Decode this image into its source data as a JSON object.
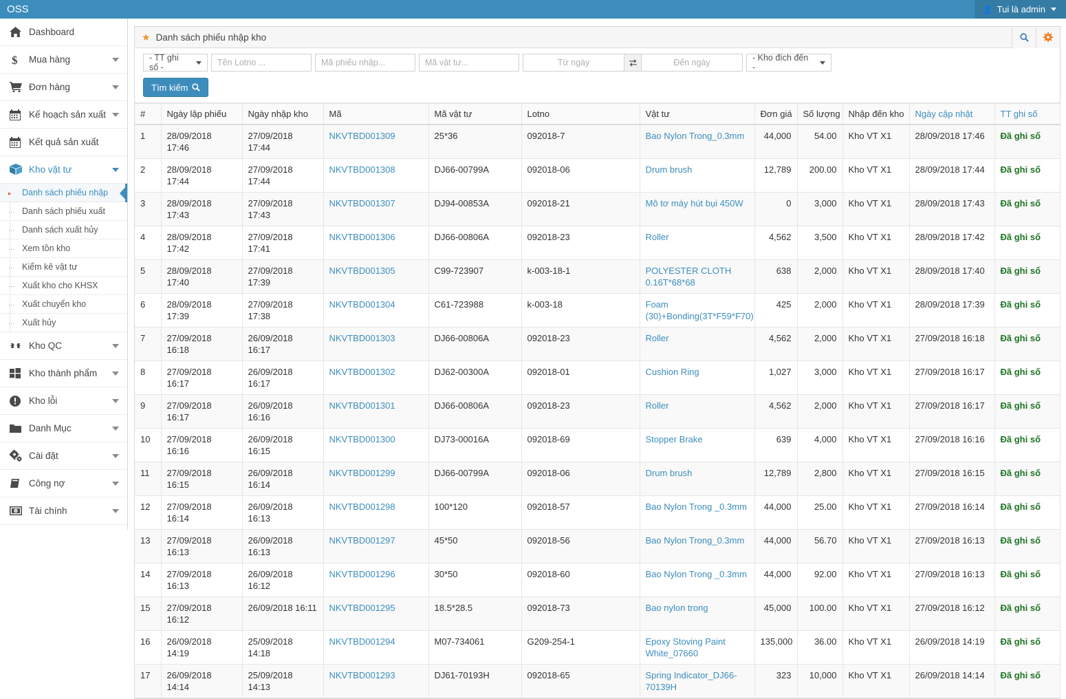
{
  "topbar": {
    "brand": "OSS",
    "user_label": "Tui là admin",
    "user_icon": "user-icon",
    "caret_icon": "caret-down-icon"
  },
  "sidebar": {
    "items": [
      {
        "label": "Dashboard",
        "icon": "home-icon",
        "has_chevron": false,
        "active": false
      },
      {
        "label": "Mua hàng",
        "icon": "dollar-icon",
        "has_chevron": true,
        "active": false
      },
      {
        "label": "Đơn hàng",
        "icon": "cart-icon",
        "has_chevron": true,
        "active": false
      },
      {
        "label": "Kế hoạch sản xuất",
        "icon": "calendar-icon",
        "has_chevron": true,
        "active": false
      },
      {
        "label": "Kết quả sản xuất",
        "icon": "calendar-icon",
        "has_chevron": false,
        "active": false
      },
      {
        "label": "Kho vật tư",
        "icon": "box-icon",
        "has_chevron": true,
        "active": true
      }
    ],
    "submenu": [
      {
        "label": "Danh sách phiếu nhập",
        "active": true
      },
      {
        "label": "Danh sách phiếu xuất",
        "active": false
      },
      {
        "label": "Danh sách xuất hủy",
        "active": false
      },
      {
        "label": "Xem tồn kho",
        "active": false
      },
      {
        "label": "Kiểm kê vật tư",
        "active": false
      },
      {
        "label": "Xuất kho cho KHSX",
        "active": false
      },
      {
        "label": "Xuất chuyển kho",
        "active": false
      },
      {
        "label": "Xuất hủy",
        "active": false
      }
    ],
    "items_after": [
      {
        "label": "Kho QC",
        "icon": "qc-icon",
        "has_chevron": true
      },
      {
        "label": "Kho thành phẩm",
        "icon": "windows-icon",
        "has_chevron": true
      },
      {
        "label": "Kho lỗi",
        "icon": "exclamation-icon",
        "has_chevron": true
      },
      {
        "label": "Danh Mục",
        "icon": "folder-icon",
        "has_chevron": true
      },
      {
        "label": "Cài đặt",
        "icon": "gears-icon",
        "has_chevron": true
      },
      {
        "label": "Công nợ",
        "icon": "book-icon",
        "has_chevron": true
      },
      {
        "label": "Tài chính",
        "icon": "money-icon",
        "has_chevron": true
      }
    ]
  },
  "panel": {
    "title": "Danh sách phiếu nhập kho",
    "star_icon": "star-icon",
    "search_icon": "search-icon",
    "gear_icon": "gear-icon"
  },
  "filters": {
    "status_select": "- TT ghi số -",
    "lotno_placeholder": "Tên Lotno ...",
    "ma_phieu_placeholder": "Mã phiếu nhập...",
    "ma_vattu_placeholder": "Mã vật tư...",
    "tu_ngay_placeholder": "Từ ngày",
    "den_ngay_placeholder": "Đến ngày",
    "swap_icon": "swap-arrows-icon",
    "kho_select": "- Kho đích đến -",
    "search_button": "Tìm kiếm",
    "search_button_icon": "search-icon"
  },
  "table": {
    "headers": [
      "#",
      "Ngày lập phiếu",
      "Ngày nhập kho",
      "Mã",
      "Mã vật tư",
      "Lotno",
      "Vật tư",
      "Đơn giá",
      "Số lượng",
      "Nhập đến kho",
      "Ngày cập nhật",
      "TT ghi số"
    ],
    "rows": [
      {
        "idx": "1",
        "ngay_lap": "28/09/2018 17:46",
        "ngay_nhap": "27/09/2018 17:44",
        "ma": "NKVTBD001309",
        "ma_vt": "25*36",
        "lotno": "092018-7",
        "vat_tu": "Bao Nylon Trong_0.3mm",
        "don_gia": "44,000",
        "so_luong": "54.00",
        "kho": "Kho VT X1",
        "ngay_cn": "28/09/2018 17:46",
        "tt": "Đã ghi số"
      },
      {
        "idx": "2",
        "ngay_lap": "28/09/2018 17:44",
        "ngay_nhap": "27/09/2018 17:44",
        "ma": "NKVTBD001308",
        "ma_vt": "DJ66-00799A",
        "lotno": "092018-06",
        "vat_tu": "Drum brush",
        "don_gia": "12,789",
        "so_luong": "200.00",
        "kho": "Kho VT X1",
        "ngay_cn": "28/09/2018 17:44",
        "tt": "Đã ghi số"
      },
      {
        "idx": "3",
        "ngay_lap": "28/09/2018 17:43",
        "ngay_nhap": "27/09/2018 17:43",
        "ma": "NKVTBD001307",
        "ma_vt": "DJ94-00853A",
        "lotno": "092018-21",
        "vat_tu": "Mô tơ máy hút bụi 450W",
        "don_gia": "0",
        "so_luong": "3,000",
        "kho": "Kho VT X1",
        "ngay_cn": "28/09/2018 17:43",
        "tt": "Đã ghi số"
      },
      {
        "idx": "4",
        "ngay_lap": "28/09/2018 17:42",
        "ngay_nhap": "27/09/2018 17:41",
        "ma": "NKVTBD001306",
        "ma_vt": "DJ66-00806A",
        "lotno": "092018-23",
        "vat_tu": "Roller",
        "don_gia": "4,562",
        "so_luong": "3,500",
        "kho": "Kho VT X1",
        "ngay_cn": "28/09/2018 17:42",
        "tt": "Đã ghi số"
      },
      {
        "idx": "5",
        "ngay_lap": "28/09/2018 17:40",
        "ngay_nhap": "27/09/2018 17:39",
        "ma": "NKVTBD001305",
        "ma_vt": "C99-723907",
        "lotno": "k-003-18-1",
        "vat_tu": "POLYESTER CLOTH 0.16T*68*68",
        "don_gia": "638",
        "so_luong": "2,000",
        "kho": "Kho VT X1",
        "ngay_cn": "28/09/2018 17:40",
        "tt": "Đã ghi số"
      },
      {
        "idx": "6",
        "ngay_lap": "28/09/2018 17:39",
        "ngay_nhap": "27/09/2018 17:38",
        "ma": "NKVTBD001304",
        "ma_vt": "C61-723988",
        "lotno": "k-003-18",
        "vat_tu": "Foam (30)+Bonding(3T*F59*F70)",
        "don_gia": "425",
        "so_luong": "2,000",
        "kho": "Kho VT X1",
        "ngay_cn": "28/09/2018 17:39",
        "tt": "Đã ghi số"
      },
      {
        "idx": "7",
        "ngay_lap": "27/09/2018 16:18",
        "ngay_nhap": "26/09/2018 16:17",
        "ma": "NKVTBD001303",
        "ma_vt": "DJ66-00806A",
        "lotno": "092018-23",
        "vat_tu": "Roller",
        "don_gia": "4,562",
        "so_luong": "2,000",
        "kho": "Kho VT X1",
        "ngay_cn": "27/09/2018 16:18",
        "tt": "Đã ghi số"
      },
      {
        "idx": "8",
        "ngay_lap": "27/09/2018 16:17",
        "ngay_nhap": "26/09/2018 16:17",
        "ma": "NKVTBD001302",
        "ma_vt": "DJ62-00300A",
        "lotno": "092018-01",
        "vat_tu": "Cushion Ring",
        "don_gia": "1,027",
        "so_luong": "3,000",
        "kho": "Kho VT X1",
        "ngay_cn": "27/09/2018 16:17",
        "tt": "Đã ghi số"
      },
      {
        "idx": "9",
        "ngay_lap": "27/09/2018 16:17",
        "ngay_nhap": "26/09/2018 16:16",
        "ma": "NKVTBD001301",
        "ma_vt": "DJ66-00806A",
        "lotno": "092018-23",
        "vat_tu": "Roller",
        "don_gia": "4,562",
        "so_luong": "2,000",
        "kho": "Kho VT X1",
        "ngay_cn": "27/09/2018 16:17",
        "tt": "Đã ghi số"
      },
      {
        "idx": "10",
        "ngay_lap": "27/09/2018 16:16",
        "ngay_nhap": "26/09/2018 16:15",
        "ma": "NKVTBD001300",
        "ma_vt": "DJ73-00016A",
        "lotno": "092018-69",
        "vat_tu": "Stopper Brake",
        "don_gia": "639",
        "so_luong": "4,000",
        "kho": "Kho VT X1",
        "ngay_cn": "27/09/2018 16:16",
        "tt": "Đã ghi số"
      },
      {
        "idx": "11",
        "ngay_lap": "27/09/2018 16:15",
        "ngay_nhap": "26/09/2018 16:14",
        "ma": "NKVTBD001299",
        "ma_vt": "DJ66-00799A",
        "lotno": "092018-06",
        "vat_tu": "Drum brush",
        "don_gia": "12,789",
        "so_luong": "2,800",
        "kho": "Kho VT X1",
        "ngay_cn": "27/09/2018 16:15",
        "tt": "Đã ghi số"
      },
      {
        "idx": "12",
        "ngay_lap": "27/09/2018 16:14",
        "ngay_nhap": "26/09/2018 16:13",
        "ma": "NKVTBD001298",
        "ma_vt": "100*120",
        "lotno": "092018-57",
        "vat_tu": "Bao Nylon Trong _0.3mm",
        "don_gia": "44,000",
        "so_luong": "25.00",
        "kho": "Kho VT X1",
        "ngay_cn": "27/09/2018 16:14",
        "tt": "Đã ghi số"
      },
      {
        "idx": "13",
        "ngay_lap": "27/09/2018 16:13",
        "ngay_nhap": "26/09/2018 16:13",
        "ma": "NKVTBD001297",
        "ma_vt": "45*50",
        "lotno": "092018-56",
        "vat_tu": "Bao Nylon Trong_0.3mm",
        "don_gia": "44,000",
        "so_luong": "56.70",
        "kho": "Kho VT X1",
        "ngay_cn": "27/09/2018 16:13",
        "tt": "Đã ghi số"
      },
      {
        "idx": "14",
        "ngay_lap": "27/09/2018 16:13",
        "ngay_nhap": "26/09/2018 16:12",
        "ma": "NKVTBD001296",
        "ma_vt": "30*50",
        "lotno": "092018-60",
        "vat_tu": "Bao Nylon Trong _0.3mm",
        "don_gia": "44,000",
        "so_luong": "92.00",
        "kho": "Kho VT X1",
        "ngay_cn": "27/09/2018 16:13",
        "tt": "Đã ghi số"
      },
      {
        "idx": "15",
        "ngay_lap": "27/09/2018 16:12",
        "ngay_nhap": "26/09/2018 16:11",
        "ma": "NKVTBD001295",
        "ma_vt": "18.5*28.5",
        "lotno": "092018-73",
        "vat_tu": "Bao nylon trong",
        "don_gia": "45,000",
        "so_luong": "100.00",
        "kho": "Kho VT X1",
        "ngay_cn": "27/09/2018 16:12",
        "tt": "Đã ghi số"
      },
      {
        "idx": "16",
        "ngay_lap": "26/09/2018 14:19",
        "ngay_nhap": "25/09/2018 14:18",
        "ma": "NKVTBD001294",
        "ma_vt": "M07-734061",
        "lotno": "G209-254-1",
        "vat_tu": "Epoxy Stoving Paint White_07660",
        "don_gia": "135,000",
        "so_luong": "36.00",
        "kho": "Kho VT X1",
        "ngay_cn": "26/09/2018 14:19",
        "tt": "Đã ghi số"
      },
      {
        "idx": "17",
        "ngay_lap": "26/09/2018 14:14",
        "ngay_nhap": "25/09/2018 14:13",
        "ma": "NKVTBD001293",
        "ma_vt": "DJ61-70193H",
        "lotno": "092018-65",
        "vat_tu": "Spring Indicator_DJ66-70139H",
        "don_gia": "323",
        "so_luong": "10,000",
        "kho": "Kho VT X1",
        "ngay_cn": "26/09/2018 14:14",
        "tt": "Đã ghi số"
      }
    ]
  },
  "colors": {
    "brand_blue": "#3c8dbc",
    "brand_blue_dark": "#357ca5",
    "link_blue": "#3c8dbc",
    "status_green": "#1d7324",
    "star_orange": "#f0932b",
    "gear_orange": "#f0832b"
  }
}
